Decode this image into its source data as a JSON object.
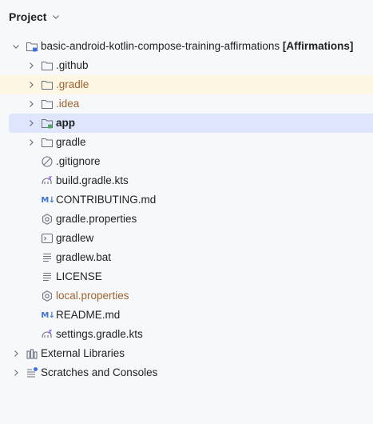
{
  "header": {
    "title": "Project"
  },
  "tree": {
    "root": {
      "name": "basic-android-kotlin-compose-training-affirmations",
      "module": "[Affirmations]"
    },
    "items": [
      {
        "label": ".github",
        "icon": "folder-icon"
      },
      {
        "label": ".gradle",
        "icon": "folder-icon"
      },
      {
        "label": ".idea",
        "icon": "folder-icon"
      },
      {
        "label": "app",
        "icon": "module-folder-icon"
      },
      {
        "label": "gradle",
        "icon": "folder-icon"
      },
      {
        "label": ".gitignore",
        "icon": "ignore-file-icon"
      },
      {
        "label": "build.gradle.kts",
        "icon": "gradle-kts-icon"
      },
      {
        "label": "CONTRIBUTING.md",
        "icon": "markdown-icon"
      },
      {
        "label": "gradle.properties",
        "icon": "properties-icon"
      },
      {
        "label": "gradlew",
        "icon": "shell-script-icon"
      },
      {
        "label": "gradlew.bat",
        "icon": "text-file-icon"
      },
      {
        "label": "LICENSE",
        "icon": "text-file-icon"
      },
      {
        "label": "local.properties",
        "icon": "properties-icon"
      },
      {
        "label": "README.md",
        "icon": "markdown-icon"
      },
      {
        "label": "settings.gradle.kts",
        "icon": "gradle-kts-icon"
      }
    ],
    "external_libraries": "External Libraries",
    "scratches": "Scratches and Consoles"
  },
  "icons": {
    "markdown_text": "M↓"
  },
  "colors": {
    "background": "#F7F8FA",
    "selected_row": "#DFE6FB",
    "ignored_row": "#FDF6E3",
    "ignored_text": "#A0632F",
    "markdown_blue": "#3D74D6",
    "module_green": "#4FAD5B"
  }
}
